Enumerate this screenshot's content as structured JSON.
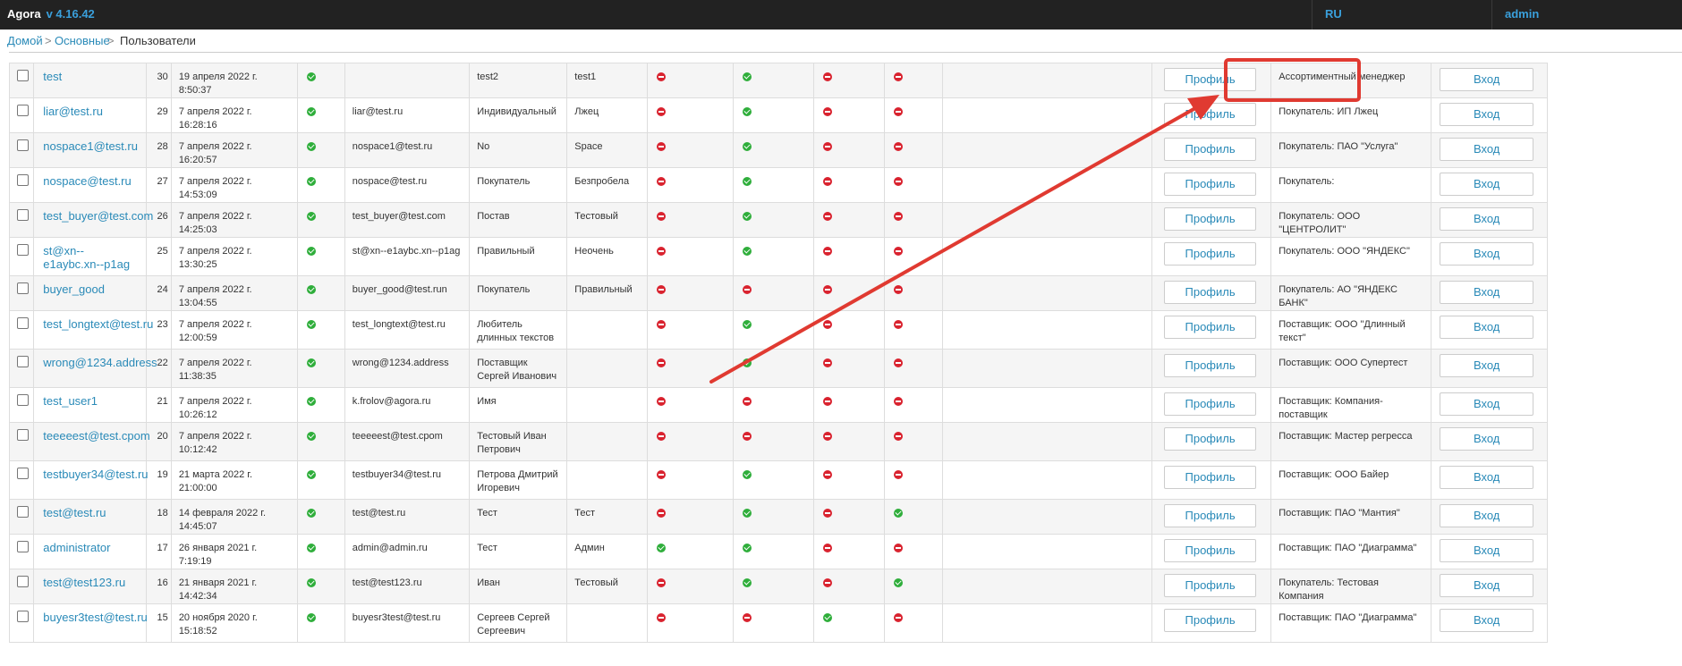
{
  "header": {
    "app_name": "Agora",
    "version": "v 4.16.42",
    "lang": "RU",
    "user": "admin"
  },
  "breadcrumb": {
    "home": "Домой",
    "sep": ">",
    "basic": "Основные",
    "current": "Пользователи"
  },
  "buttons": {
    "profile": "Профиль",
    "login": "Вход"
  },
  "colors": {
    "topbar": "#222222",
    "link": "#2a8ab8",
    "ok": "#2fae3b",
    "no": "#d9232f",
    "annotation": "#e03a31"
  },
  "rows": [
    {
      "login": "test",
      "id": "30",
      "date": "19 апреля 2022 г. 8:50:37",
      "email": "",
      "name": "test2",
      "surname": "test1",
      "s": [
        "ok",
        "no",
        "ok",
        "no",
        "no"
      ],
      "role": "Ассортиментный менеджер"
    },
    {
      "login": "liar@test.ru",
      "id": "29",
      "date": "7 апреля 2022 г. 16:28:16",
      "email": "liar@test.ru",
      "name": "Индивидуальный",
      "surname": "Лжец",
      "s": [
        "ok",
        "no",
        "ok",
        "no",
        "no"
      ],
      "role": "Покупатель: ИП Лжец"
    },
    {
      "login": "nospace1@test.ru",
      "id": "28",
      "date": "7 апреля 2022 г. 16:20:57",
      "email": "nospace1@test.ru",
      "name": "No",
      "surname": "Space",
      "s": [
        "ok",
        "no",
        "ok",
        "no",
        "no"
      ],
      "role": "Покупатель: ПАО \"Услуга\""
    },
    {
      "login": "nospace@test.ru",
      "id": "27",
      "date": "7 апреля 2022 г. 14:53:09",
      "email": "nospace@test.ru",
      "name": "Покупатель",
      "surname": "Безпробела",
      "s": [
        "ok",
        "no",
        "ok",
        "no",
        "no"
      ],
      "role": "Покупатель:"
    },
    {
      "login": "test_buyer@test.com",
      "id": "26",
      "date": "7 апреля 2022 г. 14:25:03",
      "email": "test_buyer@test.com",
      "name": "Постав",
      "surname": "Тестовый",
      "s": [
        "ok",
        "no",
        "ok",
        "no",
        "no"
      ],
      "role": "Покупатель: ООО \"ЦЕНТРОЛИТ\""
    },
    {
      "login": "st@xn--e1aybc.xn--p1ag",
      "id": "25",
      "date": "7 апреля 2022 г. 13:30:25",
      "email": "st@xn--e1aybc.xn--p1ag",
      "name": "Правильный",
      "surname": "Неочень",
      "s": [
        "ok",
        "no",
        "ok",
        "no",
        "no"
      ],
      "role": "Покупатель: ООО \"ЯНДЕКС\""
    },
    {
      "login": "buyer_good",
      "id": "24",
      "date": "7 апреля 2022 г. 13:04:55",
      "email": "buyer_good@test.run",
      "name": "Покупатель",
      "surname": "Правильный",
      "s": [
        "ok",
        "no",
        "no",
        "no",
        "no"
      ],
      "role": "Покупатель: АО \"ЯНДЕКС БАНК\""
    },
    {
      "login": "test_longtext@test.ru",
      "id": "23",
      "date": "7 апреля 2022 г. 12:00:59",
      "email": "test_longtext@test.ru",
      "name": "Любитель длинных текстов",
      "surname": "",
      "s": [
        "ok",
        "no",
        "ok",
        "no",
        "no"
      ],
      "role": "Поставщик: ООО \"Длинный текст\""
    },
    {
      "login": "wrong@1234.address",
      "id": "22",
      "date": "7 апреля 2022 г. 11:38:35",
      "email": "wrong@1234.address",
      "name": "Поставщик Сергей Иванович",
      "surname": "",
      "s": [
        "ok",
        "no",
        "ok",
        "no",
        "no"
      ],
      "role": "Поставщик: ООО Супертест"
    },
    {
      "login": "test_user1",
      "id": "21",
      "date": "7 апреля 2022 г. 10:26:12",
      "email": "k.frolov@agora.ru",
      "name": "Имя",
      "surname": "",
      "s": [
        "ok",
        "no",
        "no",
        "no",
        "no"
      ],
      "role": "Поставщик: Компания-поставщик"
    },
    {
      "login": "teeeeest@test.cpom",
      "id": "20",
      "date": "7 апреля 2022 г. 10:12:42",
      "email": "teeeeest@test.cpom",
      "name": "Тестовый Иван Петрович",
      "surname": "",
      "s": [
        "ok",
        "no",
        "no",
        "no",
        "no"
      ],
      "role": "Поставщик: Мастер регресса"
    },
    {
      "login": "testbuyer34@test.ru",
      "id": "19",
      "date": "21 марта 2022 г. 21:00:00",
      "email": "testbuyer34@test.ru",
      "name": "Петрова Дмитрий Игоревич",
      "surname": "",
      "s": [
        "ok",
        "no",
        "ok",
        "no",
        "no"
      ],
      "role": "Поставщик: ООО Байер"
    },
    {
      "login": "test@test.ru",
      "id": "18",
      "date": "14 февраля 2022 г. 14:45:07",
      "email": "test@test.ru",
      "name": "Тест",
      "surname": "Тест",
      "s": [
        "ok",
        "no",
        "ok",
        "no",
        "ok"
      ],
      "role": "Поставщик: ПАО \"Мантия\""
    },
    {
      "login": "administrator",
      "id": "17",
      "date": "26 января 2021 г. 7:19:19",
      "email": "admin@admin.ru",
      "name": "Тест",
      "surname": "Админ",
      "s": [
        "ok",
        "ok",
        "ok",
        "no",
        "no"
      ],
      "role": "Поставщик: ПАО \"Диаграмма\""
    },
    {
      "login": "test@test123.ru",
      "id": "16",
      "date": "21 января 2021 г. 14:42:34",
      "email": "test@test123.ru",
      "name": "Иван",
      "surname": "Тестовый",
      "s": [
        "ok",
        "no",
        "ok",
        "no",
        "ok"
      ],
      "role": "Покупатель: Тестовая Компания"
    },
    {
      "login": "buyesr3test@test.ru",
      "id": "15",
      "date": "20 ноября 2020 г. 15:18:52",
      "email": "buyesr3test@test.ru",
      "name": "Сергеев Сергей Сергеевич",
      "surname": "",
      "s": [
        "ok",
        "no",
        "no",
        "ok",
        "no"
      ],
      "role": "Поставщик: ПАО \"Диаграмма\""
    }
  ]
}
